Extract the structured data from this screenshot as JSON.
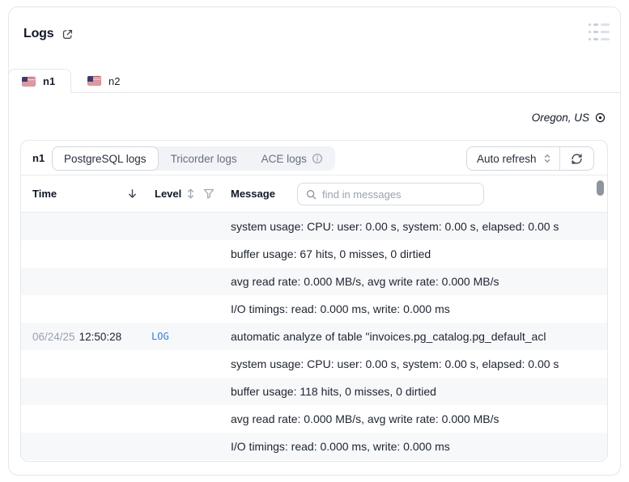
{
  "header": {
    "title": "Logs"
  },
  "tabs": [
    {
      "label": "n1"
    },
    {
      "label": "n2"
    }
  ],
  "region": {
    "label": "Oregon, US"
  },
  "panel": {
    "instance_label": "n1",
    "log_source_tabs": [
      {
        "label": "PostgreSQL logs",
        "active": true
      },
      {
        "label": "Tricorder logs",
        "active": false
      },
      {
        "label": "ACE logs",
        "active": false,
        "info": true
      }
    ],
    "refresh": {
      "mode_label": "Auto refresh"
    },
    "table": {
      "headers": {
        "time": "Time",
        "level": "Level",
        "message": "Message"
      },
      "search": {
        "placeholder": "find in messages"
      },
      "rows": [
        {
          "date": "",
          "time": "",
          "level": "",
          "message": "system usage: CPU: user: 0.00 s, system: 0.00 s, elapsed: 0.00 s"
        },
        {
          "date": "",
          "time": "",
          "level": "",
          "message": "buffer usage: 67 hits, 0 misses, 0 dirtied"
        },
        {
          "date": "",
          "time": "",
          "level": "",
          "message": "avg read rate: 0.000 MB/s, avg write rate: 0.000 MB/s"
        },
        {
          "date": "",
          "time": "",
          "level": "",
          "message": "I/O timings: read: 0.000 ms, write: 0.000 ms"
        },
        {
          "date": "06/24/25",
          "time": "12:50:28",
          "level": "LOG",
          "message": "automatic analyze of table \"invoices.pg_catalog.pg_default_acl"
        },
        {
          "date": "",
          "time": "",
          "level": "",
          "message": "system usage: CPU: user: 0.00 s, system: 0.00 s, elapsed: 0.00 s"
        },
        {
          "date": "",
          "time": "",
          "level": "",
          "message": "buffer usage: 118 hits, 0 misses, 0 dirtied"
        },
        {
          "date": "",
          "time": "",
          "level": "",
          "message": "avg read rate: 0.000 MB/s, avg write rate: 0.000 MB/s"
        },
        {
          "date": "",
          "time": "",
          "level": "",
          "message": "I/O timings: read: 0.000 ms, write: 0.000 ms"
        }
      ]
    }
  },
  "colors": {
    "accent_blue": "#2f80ed",
    "row_alt": "#f7f8fa",
    "border": "#e4e7ec"
  }
}
